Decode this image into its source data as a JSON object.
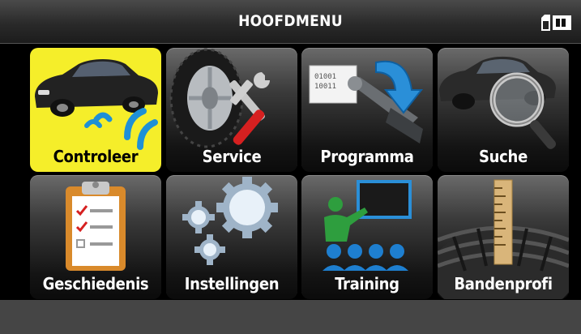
{
  "header": {
    "title": "HOOFDMENU",
    "icons": [
      "sd-card-icon",
      "battery-icon"
    ]
  },
  "menu": {
    "selected_index": 0,
    "items": [
      {
        "label": "Controleer",
        "icon": "car-sensor-signal-icon"
      },
      {
        "label": "Service",
        "icon": "tire-tools-icon"
      },
      {
        "label": "Programma",
        "icon": "program-sensor-icon"
      },
      {
        "label": "Suche",
        "icon": "car-magnifier-icon"
      },
      {
        "label": "Geschiedenis",
        "icon": "clipboard-checklist-icon"
      },
      {
        "label": "Instellingen",
        "icon": "gears-icon"
      },
      {
        "label": "Training",
        "icon": "training-classroom-icon"
      },
      {
        "label": "Bandenprofi",
        "icon": "tire-tread-ruler-icon"
      }
    ]
  },
  "colors": {
    "selected_tile": "#f5ee2a",
    "signal_blue": "#1e90d6",
    "footer": "#454545"
  }
}
